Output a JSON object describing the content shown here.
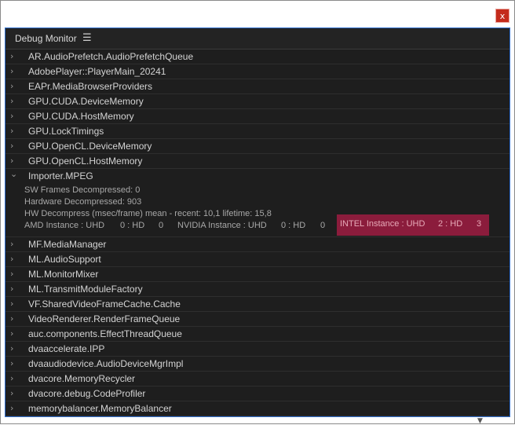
{
  "window": {
    "close_label": "x"
  },
  "panel": {
    "title": "Debug Monitor",
    "menu_icon": "☰"
  },
  "items_before": [
    "AR.AudioPrefetch.AudioPrefetchQueue",
    "AdobePlayer::PlayerMain_20241",
    "EAPr.MediaBrowserProviders",
    "GPU.CUDA.DeviceMemory",
    "GPU.CUDA.HostMemory",
    "GPU.LockTimings",
    "GPU.OpenCL.DeviceMemory",
    "GPU.OpenCL.HostMemory"
  ],
  "expanded_item": {
    "label": "Importer.MPEG",
    "details": [
      "SW Frames Decompressed: 0",
      "Hardware Decompressed: 903",
      "HW Decompress (msec/frame) mean - recent:  10,1 lifetime:  15,8"
    ],
    "instances": {
      "amd_label": "AMD Instance : UHD",
      "amd_hd": "0 : HD",
      "amd_count": "0",
      "nvidia_label": "NVIDIA Instance : UHD",
      "nvidia_hd": "0 : HD",
      "nvidia_count": "0",
      "intel_label": "INTEL Instance : UHD",
      "intel_hd": "2 : HD",
      "intel_count": "3"
    }
  },
  "items_after": [
    "MF.MediaManager",
    "ML.AudioSupport",
    "ML.MonitorMixer",
    "ML.TransmitModuleFactory",
    "VF.SharedVideoFrameCache.Cache",
    "VideoRenderer.RenderFrameQueue",
    "auc.components.EffectThreadQueue",
    "dvaaccelerate.IPP",
    "dvaaudiodevice.AudioDeviceMgrImpl",
    "dvacore.MemoryRecycler",
    "dvacore.debug.CodeProfiler",
    "memorybalancer.MemoryBalancer"
  ],
  "icons": {
    "collapsed": "›",
    "expanded": "⌄",
    "filter": "▼"
  },
  "colors": {
    "panel_bg": "#1e1e1e",
    "focus_border": "#2f6fd0",
    "highlight": "#8b1c3c",
    "close_button": "#c42b1c"
  }
}
